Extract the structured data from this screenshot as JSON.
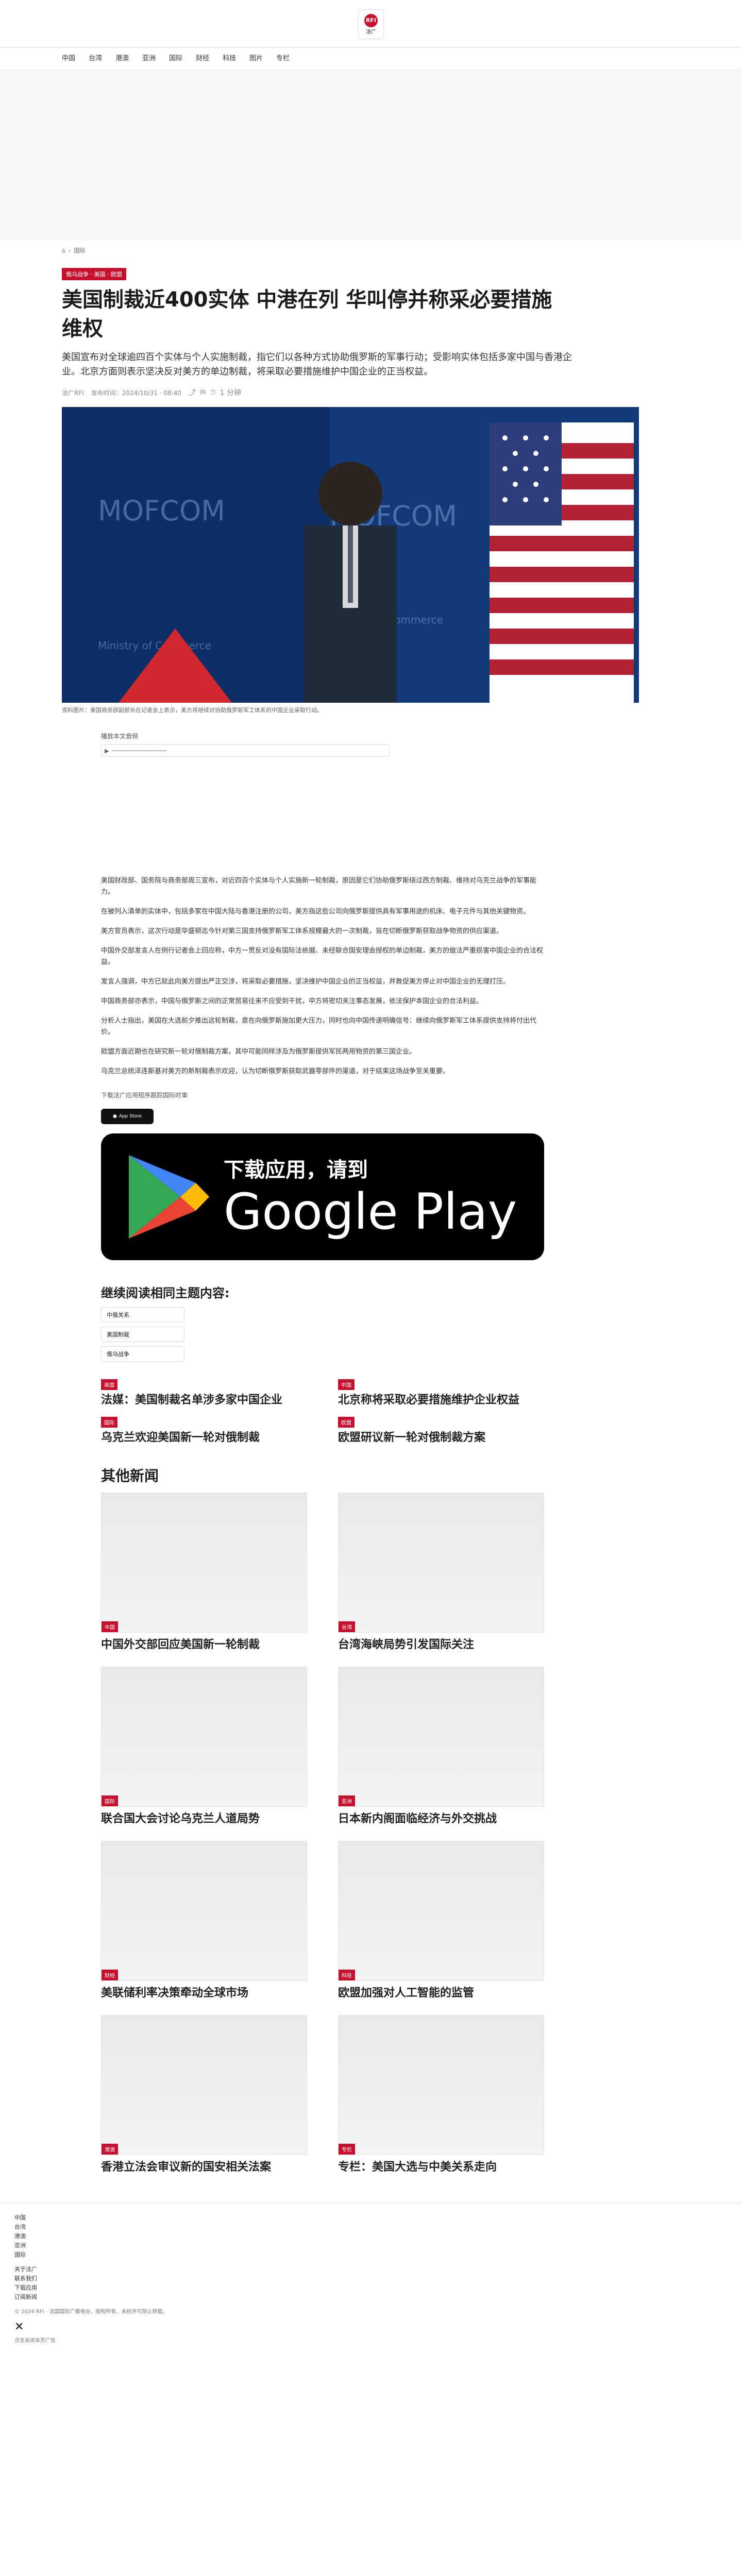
{
  "header": {
    "logo_text": "RFI",
    "logo_sub": "法广"
  },
  "nav": {
    "items": [
      "中国",
      "台湾",
      "港澳",
      "亚洲",
      "国际",
      "财经",
      "科技",
      "图片",
      "专栏"
    ]
  },
  "breadcrumb": {
    "home": "⌂",
    "section": "国际"
  },
  "article": {
    "category": "俄乌战争 · 美国 · 欧盟",
    "headline": "美国制裁近400实体 中港在列 华叫停并称采必要措施维权",
    "summary": "美国宣布对全球逾四百个实体与个人实施制裁，指它们以各种方式协助俄罗斯的军事行动；受影响实体包括多家中国与香港企业。北京方面则表示坚决反对美方的单边制裁，将采取必要措施维护中国企业的正当权益。",
    "author": "法广RFI",
    "date": "发布时间：2024/10/31 · 08:40",
    "read_time": "1 分钟",
    "caption": "资料图片：美国商务部副部长在记者会上表示，美方将继续对协助俄罗斯军工体系的中国企业采取行动。",
    "audio_label": "播放本文音频",
    "body": [
      "美国财政部、国务院与商务部周三宣布，对近四百个实体与个人实施新一轮制裁，原因是它们协助俄罗斯绕过西方制裁、维持对乌克兰战争的军事能力。",
      "在被列入清单的实体中，包括多家在中国大陆与香港注册的公司，美方指这些公司向俄罗斯提供具有军事用途的机床、电子元件与其他关键物资。",
      "美方官员表示，这次行动是华盛顿迄今针对第三国支持俄罗斯军工体系规模最大的一次制裁，旨在切断俄罗斯获取战争物资的供应渠道。",
      "中国外交部发言人在例行记者会上回应称，中方一贯反对没有国际法依据、未经联合国安理会授权的单边制裁，美方的做法严重损害中国企业的合法权益。",
      "发言人强调，中方已就此向美方提出严正交涉，将采取必要措施，坚决维护中国企业的正当权益，并敦促美方停止对中国企业的无理打压。",
      "中国商务部亦表示，中国与俄罗斯之间的正常贸易往来不应受到干扰，中方将密切关注事态发展，依法保护本国企业的合法利益。",
      "分析人士指出，美国在大选前夕推出这轮制裁，意在向俄罗斯施加更大压力，同时也向中国传递明确信号：继续向俄罗斯军工体系提供支持将付出代价。",
      "欧盟方面近期也在研究新一轮对俄制裁方案，其中可能同样涉及为俄罗斯提供军民两用物资的第三国企业。",
      "乌克兰总统泽连斯基对美方的新制裁表示欢迎，认为切断俄罗斯获取武器零部件的渠道，对于结束这场战争至关重要。"
    ],
    "more_link": "下载法广应用程序跟踪国际时事"
  },
  "apps": {
    "apple_label": "App Store",
    "gplay_top": "下载应用，请到",
    "gplay_big": "Google Play"
  },
  "continue": {
    "title": "继续阅读相同主题内容:",
    "tags": [
      "中俄关系",
      "美国制裁",
      "俄乌战争"
    ]
  },
  "related": [
    {
      "badge": "美国",
      "title": "法媒：美国制裁名单涉多家中国企业"
    },
    {
      "badge": "中国",
      "title": "北京称将采取必要措施维护企业权益"
    },
    {
      "badge": "国际",
      "title": "乌克兰欢迎美国新一轮对俄制裁"
    },
    {
      "badge": "欧盟",
      "title": "欧盟研议新一轮对俄制裁方案"
    }
  ],
  "other_news": {
    "title": "其他新闻",
    "items": [
      {
        "badge": "中国",
        "title": "中国外交部回应美国新一轮制裁"
      },
      {
        "badge": "台湾",
        "title": "台湾海峡局势引发国际关注"
      },
      {
        "badge": "国际",
        "title": "联合国大会讨论乌克兰人道局势"
      },
      {
        "badge": "亚洲",
        "title": "日本新内阁面临经济与外交挑战"
      },
      {
        "badge": "财经",
        "title": "美联储利率决策牵动全球市场"
      },
      {
        "badge": "科技",
        "title": "欧盟加强对人工智能的监管"
      },
      {
        "badge": "港澳",
        "title": "香港立法会审议新的国安相关法案"
      },
      {
        "badge": "专栏",
        "title": "专栏：美国大选与中美关系走向"
      }
    ]
  },
  "footer": {
    "items": [
      "中国",
      "台湾",
      "港澳",
      "亚洲",
      "国际"
    ],
    "more": [
      "关于法广",
      "联系我们",
      "下载应用",
      "订阅新闻"
    ],
    "copyright": "© 2024 RFI - 法国国际广播电台，版权所有，未经许可禁止转载。",
    "close": "×",
    "note": "点击关闭本页广告"
  },
  "colors": {
    "accent": "#c8102e"
  }
}
